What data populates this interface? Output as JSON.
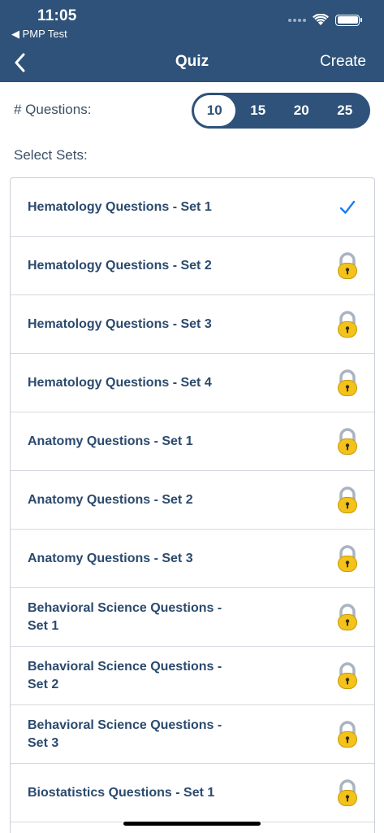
{
  "status_bar": {
    "time": "11:05",
    "back_app": "◀ PMP Test"
  },
  "nav": {
    "title": "Quiz",
    "action": "Create",
    "back_icon": "chevron-left-icon"
  },
  "questions": {
    "label": "# Questions:",
    "options": [
      "10",
      "15",
      "20",
      "25"
    ],
    "selected": "10"
  },
  "sets": {
    "label": "Select Sets:",
    "items": [
      {
        "label": "Hematology Questions - Set 1",
        "state": "selected"
      },
      {
        "label": "Hematology Questions - Set 2",
        "state": "locked"
      },
      {
        "label": "Hematology Questions - Set 3",
        "state": "locked"
      },
      {
        "label": "Hematology Questions - Set 4",
        "state": "locked"
      },
      {
        "label": "Anatomy Questions - Set 1",
        "state": "locked"
      },
      {
        "label": "Anatomy Questions - Set 2",
        "state": "locked"
      },
      {
        "label": "Anatomy Questions - Set 3",
        "state": "locked"
      },
      {
        "label": "Behavioral Science Questions - Set 1",
        "state": "locked"
      },
      {
        "label": "Behavioral Science Questions - Set 2",
        "state": "locked"
      },
      {
        "label": "Behavioral Science Questions - Set 3",
        "state": "locked"
      },
      {
        "label": "Biostatistics Questions - Set 1",
        "state": "locked"
      }
    ]
  },
  "colors": {
    "header_bg": "#2e5279",
    "text_primary": "#2b4a6e",
    "checkmark": "#1a7cf5",
    "lock_body": "#f3c21b"
  }
}
